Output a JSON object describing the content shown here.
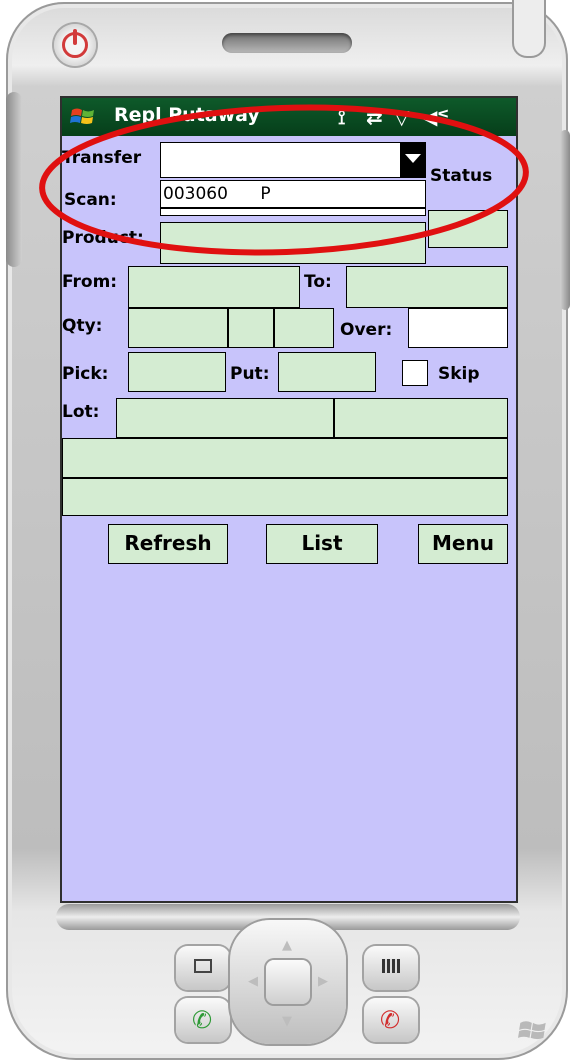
{
  "app": {
    "title": "Repl Putaway",
    "status_icons": [
      "antenna-icon",
      "sync-icon",
      "signal-icon",
      "volume-icon"
    ]
  },
  "form": {
    "transfer_label": "Transfer",
    "transfer_value": "",
    "scan_label": "Scan:",
    "scan_value": "003060      P",
    "status_label": "Status",
    "product_label": "Product:",
    "from_label": "From:",
    "to_label": "To:",
    "qty_label": "Qty:",
    "over_label": "Over:",
    "pick_label": "Pick:",
    "put_label": "Put:",
    "skip_label": "Skip",
    "skip_checked": false,
    "lot_label": "Lot:"
  },
  "buttons": {
    "refresh": "Refresh",
    "list": "List",
    "menu": "Menu"
  },
  "colors": {
    "screen_bg": "#c8c4fb",
    "field_bg": "#d4ecd2",
    "titlebar_bg": "#0a4d22",
    "highlight_ellipse": "#e01010"
  }
}
